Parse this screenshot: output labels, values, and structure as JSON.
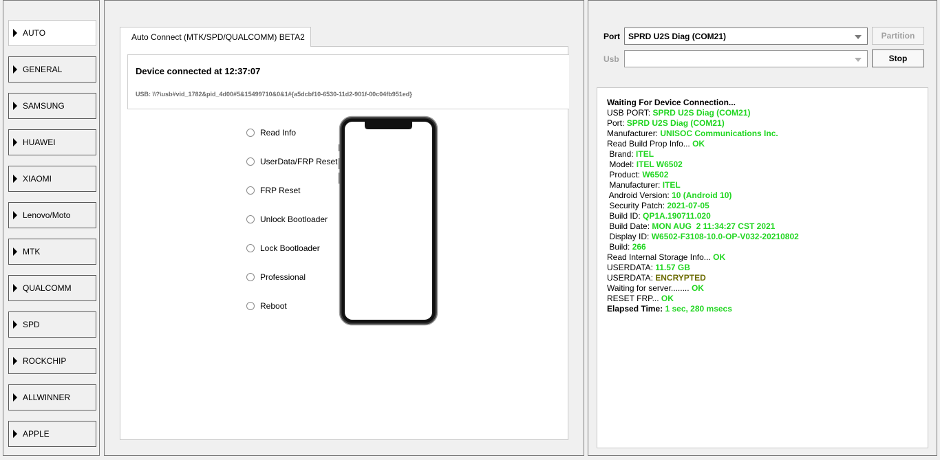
{
  "sidebar": {
    "items": [
      {
        "label": "AUTO",
        "active": true
      },
      {
        "label": "GENERAL"
      },
      {
        "label": "SAMSUNG"
      },
      {
        "label": "HUAWEI"
      },
      {
        "label": "XIAOMI"
      },
      {
        "label": "Lenovo/Moto"
      },
      {
        "label": "MTK"
      },
      {
        "label": "QUALCOMM"
      },
      {
        "label": "SPD"
      },
      {
        "label": "ROCKCHIP"
      },
      {
        "label": "ALLWINNER"
      },
      {
        "label": "APPLE"
      }
    ]
  },
  "center": {
    "tab_label": "Auto Connect (MTK/SPD/QUALCOMM) BETA2",
    "device_title": "Device connected at 12:37:07",
    "usb_path": "USB: \\\\?\\usb#vid_1782&pid_4d00#5&15499710&0&1#{a5dcbf10-6530-11d2-901f-00c04fb951ed}",
    "options": [
      "Read Info",
      "UserData/FRP Reset",
      "FRP Reset",
      "Unlock Bootloader",
      "Lock Bootloader",
      "Professional",
      "Reboot"
    ]
  },
  "right": {
    "port_label": "Port",
    "port_value": "SPRD U2S Diag (COM21)",
    "usb_label": "Usb",
    "usb_value": "",
    "partition_label": "Partition",
    "stop_label": "Stop"
  },
  "log": {
    "lines": [
      {
        "k": "Waiting For Device Connection...",
        "kb": true
      },
      {
        "k": "USB PORT: ",
        "v": "SPRD U2S Diag (COM21)"
      },
      {
        "k": "Port: ",
        "v": "SPRD U2S Diag (COM21)"
      },
      {
        "k": "Manufacturer: ",
        "v": "UNISOC Communications Inc."
      },
      {
        "k": "Read Build Prop Info... ",
        "v": "OK"
      },
      {
        "k": " Brand: ",
        "v": "ITEL"
      },
      {
        "k": " Model: ",
        "v": "ITEL W6502"
      },
      {
        "k": " Product: ",
        "v": "W6502"
      },
      {
        "k": " Manufacturer: ",
        "v": "ITEL"
      },
      {
        "k": " Android Version: ",
        "v": "10 (Android 10)"
      },
      {
        "k": " Security Patch: ",
        "v": "2021-07-05"
      },
      {
        "k": " Build ID: ",
        "v": "QP1A.190711.020"
      },
      {
        "k": " Build Date: ",
        "v": "MON AUG  2 11:34:27 CST 2021"
      },
      {
        "k": " Display ID: ",
        "v": "W6502-F3108-10.0-OP-V032-20210802"
      },
      {
        "k": " Build: ",
        "v": "266"
      },
      {
        "k": "Read Internal Storage Info... ",
        "v": "OK"
      },
      {
        "k": "USERDATA: ",
        "v": "11.57 GB"
      },
      {
        "k": "USERDATA: ",
        "v": "ENCRYPTED",
        "olive": true
      },
      {
        "k": "Waiting for server........ ",
        "v": "OK"
      },
      {
        "k": "RESET FRP... ",
        "v": "OK"
      },
      {
        "k": "Elapsed Time: ",
        "v": "1 sec, 280 msecs",
        "kb": true
      }
    ]
  }
}
